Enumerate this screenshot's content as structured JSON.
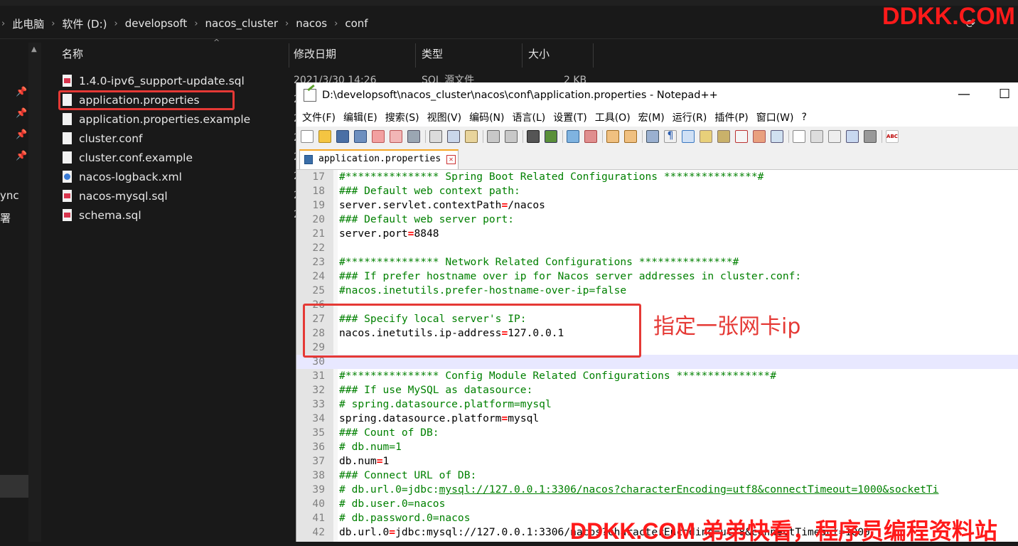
{
  "explorer": {
    "breadcrumbs": [
      "此电脑",
      "软件 (D:)",
      "developsoft",
      "nacos_cluster",
      "nacos",
      "conf"
    ],
    "columns": {
      "name": "名称",
      "date": "修改日期",
      "type": "类型",
      "size": "大小"
    },
    "files": [
      {
        "name": "1.4.0-ipv6_support-update.sql",
        "icon": "sql"
      },
      {
        "name": "application.properties",
        "icon": "doc"
      },
      {
        "name": "application.properties.example",
        "icon": "doc"
      },
      {
        "name": "cluster.conf",
        "icon": "doc"
      },
      {
        "name": "cluster.conf.example",
        "icon": "doc"
      },
      {
        "name": "nacos-logback.xml",
        "icon": "xml"
      },
      {
        "name": "nacos-mysql.sql",
        "icon": "sql"
      },
      {
        "name": "schema.sql",
        "icon": "sql"
      }
    ],
    "first_row_date": "2021/3/30 14:26",
    "first_row_type": "SQL 源文件",
    "first_row_size": "2 KB",
    "date_partial": [
      "2",
      "2",
      "2",
      "2",
      "2",
      "2",
      "2"
    ],
    "sidebar_text": [
      "ync",
      "署"
    ]
  },
  "notepad": {
    "title": "D:\\developsoft\\nacos_cluster\\nacos\\conf\\application.properties - Notepad++",
    "menu": [
      "文件(F)",
      "编辑(E)",
      "搜索(S)",
      "视图(V)",
      "编码(N)",
      "语言(L)",
      "设置(T)",
      "工具(O)",
      "宏(M)",
      "运行(R)",
      "插件(P)",
      "窗口(W)",
      "?"
    ],
    "tab_label": "application.properties",
    "lines": [
      {
        "n": "17",
        "c": "#*************** Spring Boot Related Configurations ***************#"
      },
      {
        "n": "18",
        "c": "### Default web context path:"
      },
      {
        "n": "19",
        "k": "server.servlet.contextPath",
        "v": "/nacos"
      },
      {
        "n": "20",
        "c": "### Default web server port:"
      },
      {
        "n": "21",
        "k": "server.port",
        "v": "8848"
      },
      {
        "n": "22"
      },
      {
        "n": "23",
        "c": "#*************** Network Related Configurations ***************#"
      },
      {
        "n": "24",
        "c": "### If prefer hostname over ip for Nacos server addresses in cluster.conf:"
      },
      {
        "n": "25",
        "c": "#nacos.inetutils.prefer-hostname-over-ip=false"
      },
      {
        "n": "26"
      },
      {
        "n": "27",
        "c": "### Specify local server's IP:"
      },
      {
        "n": "28",
        "k": "nacos.inetutils.ip-address",
        "v": "127.0.0.1"
      },
      {
        "n": "29"
      },
      {
        "n": "30",
        "cur": true
      },
      {
        "n": "31",
        "c": "#*************** Config Module Related Configurations ***************#"
      },
      {
        "n": "32",
        "c": "### If use MySQL as datasource:"
      },
      {
        "n": "33",
        "c": "# spring.datasource.platform=mysql"
      },
      {
        "n": "34",
        "k": "spring.datasource.platform",
        "v": "mysql"
      },
      {
        "n": "35",
        "c": "### Count of DB:"
      },
      {
        "n": "36",
        "c": "# db.num=1"
      },
      {
        "n": "37",
        "k": "db.num",
        "v": "1"
      },
      {
        "n": "38",
        "c": "### Connect URL of DB:"
      },
      {
        "n": "39",
        "c": "# db.url.0=jdbc:",
        "u": "mysql://127.0.0.1:3306/nacos?characterEncoding=utf8&connectTimeout=1000&socketTi"
      },
      {
        "n": "40",
        "c": "# db.user.0=nacos"
      },
      {
        "n": "41",
        "c": "# db.password.0=nacos"
      },
      {
        "n": "42",
        "k": "db.url.0",
        "v": "jdbc:mysql://127.0.0.1:3306/nacos?characterEncoding=utf8&connectTimeout=1000"
      }
    ]
  },
  "annotation": "指定一张网卡ip",
  "watermark_top": "DDKK.COM",
  "watermark_bottom": "DDKK.COM 弟弟快看，程序员编程资料站",
  "colors": {
    "highlight": "#e53935",
    "comment": "#008000",
    "operator": "#ff0000"
  }
}
